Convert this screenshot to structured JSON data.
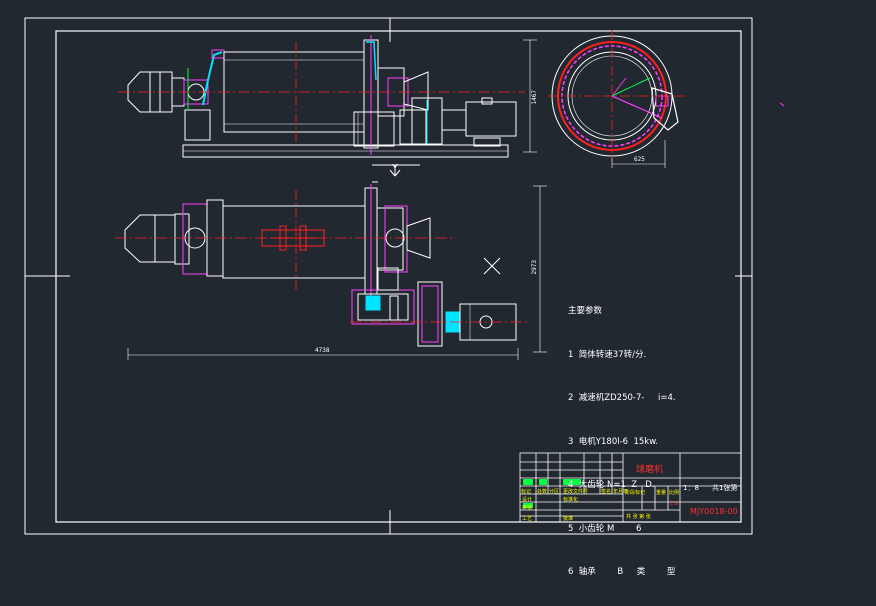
{
  "drawing": {
    "title": "球磨机",
    "drawing_number": "MJY0018-00",
    "scale_label": "1：8",
    "sheet_note": "共1张第",
    "mark_y": "Y"
  },
  "dimensions": {
    "front_height": "1467",
    "plan_height": "2973",
    "plan_length": "4738",
    "ring_width": "625"
  },
  "spec_list": {
    "heading": "主要参数",
    "items": [
      "1  简体转速37转/分.",
      "2  减速机ZD250-7-     i=4.",
      "3  电机Y180l-6  15kw.",
      "4  大齿轮 N=1  Z   D.",
      "5  小齿轮 M        6",
      "6  轴承        B     类        型"
    ]
  },
  "title_block": {
    "row_labels": [
      "标记",
      "处数",
      "分区",
      "更改文件号",
      "签名",
      "年月日"
    ],
    "designer": "设计",
    "checker": "审核",
    "process": "工艺",
    "standard": "标准化",
    "approve": "批准",
    "stage_labels": [
      "阶段标记",
      "重量",
      "比例"
    ],
    "stage_values": [
      "",
      "",
      "1:8"
    ],
    "footer": "共  张  第  张"
  },
  "colors": {
    "background": "#212830",
    "line_white": "#ffffff",
    "line_red": "#ff2020",
    "line_magenta": "#ff40ff",
    "line_cyan": "#00e5ff",
    "line_green": "#00ff40",
    "line_yellow": "#ffff00"
  }
}
